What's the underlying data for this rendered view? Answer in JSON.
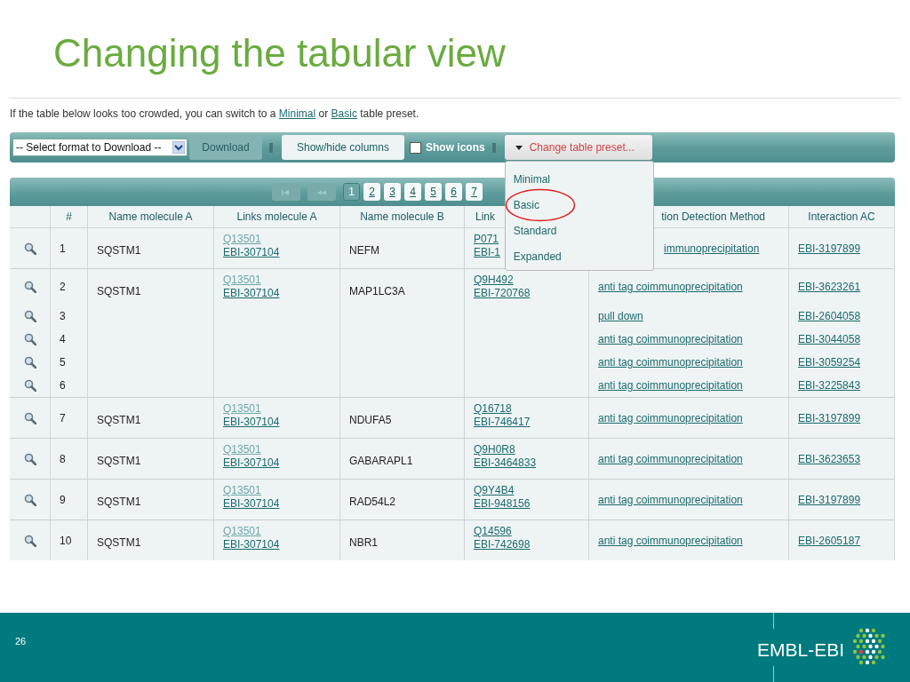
{
  "slide": {
    "title": "Changing the tabular view",
    "page_number": "26",
    "logo_text": "EMBL-EBI"
  },
  "intro": {
    "before": "If the table below looks too crowded, you can switch to a",
    "link_1": "Minimal",
    "middle": "or",
    "link_2": "Basic",
    "after": "table preset."
  },
  "toolbar": {
    "format_select": "-- Select format to Download --",
    "download_button": {
      "label": "Download",
      "disabled": true
    },
    "columns_button": "Show/hide columns",
    "show_icons": {
      "label": "Show icons",
      "checked": false
    },
    "preset_button": "Change table preset...",
    "preset_menu": [
      {
        "label": "Minimal",
        "circled": false
      },
      {
        "label": "Basic",
        "circled": true
      },
      {
        "label": "Standard",
        "circled": false
      },
      {
        "label": "Expanded",
        "circled": false
      }
    ]
  },
  "pager": {
    "pages": [
      {
        "label": "1",
        "selected": true
      },
      {
        "label": "2",
        "selected": false
      },
      {
        "label": "3",
        "selected": false
      },
      {
        "label": "4",
        "selected": false
      },
      {
        "label": "5",
        "selected": false
      },
      {
        "label": "6",
        "selected": false
      },
      {
        "label": "7",
        "selected": false
      }
    ]
  },
  "table": {
    "columns": [
      "#",
      "Name molecule A",
      "Links molecule A",
      "Name molecule B",
      "Link",
      "tion Detection Method",
      "Interaction AC"
    ],
    "rows": [
      {
        "name_a": "SQSTM1",
        "links_a": [
          {
            "text": "Q13501",
            "visited": true
          },
          {
            "text": "EBI-307104",
            "visited": false
          }
        ],
        "name_b": "NEFM",
        "links_b": [
          {
            "text": "P071",
            "visited": false
          },
          {
            "text": "EBI-1",
            "visited": false
          }
        ],
        "interactions": [
          {
            "num": "1",
            "method": "immunoprecipitation",
            "ac": "EBI-3197899"
          }
        ]
      },
      {
        "name_a": "SQSTM1",
        "links_a": [
          {
            "text": "Q13501",
            "visited": true
          },
          {
            "text": "EBI-307104",
            "visited": false
          }
        ],
        "name_b": "MAP1LC3A",
        "links_b": [
          {
            "text": "Q9H492",
            "visited": false
          },
          {
            "text": "EBI-720768",
            "visited": false
          }
        ],
        "interactions": [
          {
            "num": "2",
            "method": "anti tag coimmunoprecipitation",
            "ac": "EBI-3623261"
          },
          {
            "num": "3",
            "method": "pull down",
            "ac": "EBI-2604058"
          },
          {
            "num": "4",
            "method": "anti tag coimmunoprecipitation",
            "ac": "EBI-3044058"
          },
          {
            "num": "5",
            "method": "anti tag coimmunoprecipitation",
            "ac": "EBI-3059254"
          },
          {
            "num": "6",
            "method": "anti tag coimmunoprecipitation",
            "ac": "EBI-3225843"
          }
        ]
      },
      {
        "name_a": "SQSTM1",
        "links_a": [
          {
            "text": "Q13501",
            "visited": true
          },
          {
            "text": "EBI-307104",
            "visited": false
          }
        ],
        "name_b": "NDUFA5",
        "links_b": [
          {
            "text": "Q16718",
            "visited": false
          },
          {
            "text": "EBI-746417",
            "visited": false
          }
        ],
        "interactions": [
          {
            "num": "7",
            "method": "anti tag coimmunoprecipitation",
            "ac": "EBI-3197899"
          }
        ]
      },
      {
        "name_a": "SQSTM1",
        "links_a": [
          {
            "text": "Q13501",
            "visited": true
          },
          {
            "text": "EBI-307104",
            "visited": false
          }
        ],
        "name_b": "GABARAPL1",
        "links_b": [
          {
            "text": "Q9H0R8",
            "visited": false
          },
          {
            "text": "EBI-3464833",
            "visited": false
          }
        ],
        "interactions": [
          {
            "num": "8",
            "method": "anti tag coimmunoprecipitation",
            "ac": "EBI-3623653"
          }
        ]
      },
      {
        "name_a": "SQSTM1",
        "links_a": [
          {
            "text": "Q13501",
            "visited": true
          },
          {
            "text": "EBI-307104",
            "visited": false
          }
        ],
        "name_b": "RAD54L2",
        "links_b": [
          {
            "text": "Q9Y4B4",
            "visited": false
          },
          {
            "text": "EBI-948156",
            "visited": false
          }
        ],
        "interactions": [
          {
            "num": "9",
            "method": "anti tag coimmunoprecipitation",
            "ac": "EBI-3197899"
          }
        ]
      },
      {
        "name_a": "SQSTM1",
        "links_a": [
          {
            "text": "Q13501",
            "visited": true
          },
          {
            "text": "EBI-307104",
            "visited": false
          }
        ],
        "name_b": "NBR1",
        "links_b": [
          {
            "text": "Q14596",
            "visited": false
          },
          {
            "text": "EBI-742698",
            "visited": false
          }
        ],
        "interactions": [
          {
            "num": "10",
            "method": "anti tag coimmunoprecipitation",
            "ac": "EBI-2605187"
          }
        ]
      }
    ]
  }
}
